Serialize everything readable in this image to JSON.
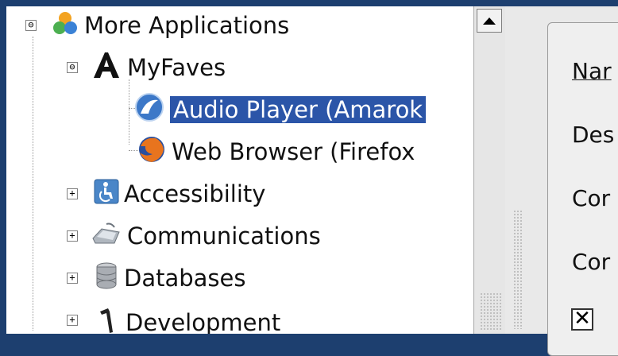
{
  "tree": {
    "items": [
      {
        "label": "More Applications",
        "icon": "more-applications-icon",
        "expander": "⊖"
      },
      {
        "label": "MyFaves",
        "icon": "font-a-icon",
        "expander": "⊖"
      },
      {
        "label": "Audio Player (Amarok",
        "icon": "amarok-icon"
      },
      {
        "label": "Web Browser (Firefox",
        "icon": "firefox-icon"
      },
      {
        "label": "Accessibility",
        "icon": "accessibility-icon",
        "expander": "+"
      },
      {
        "label": "Communications",
        "icon": "communications-icon",
        "expander": "+"
      },
      {
        "label": "Databases",
        "icon": "databases-icon",
        "expander": "+"
      },
      {
        "label": "Development",
        "icon": "development-icon",
        "expander": "+"
      }
    ]
  },
  "form": {
    "labels": [
      "Nar",
      "Des",
      "Cor",
      "Cor"
    ],
    "checkbox_mark": "✕"
  },
  "colors": {
    "selection": "#2b55a8",
    "frame": "#1d3f6f"
  }
}
